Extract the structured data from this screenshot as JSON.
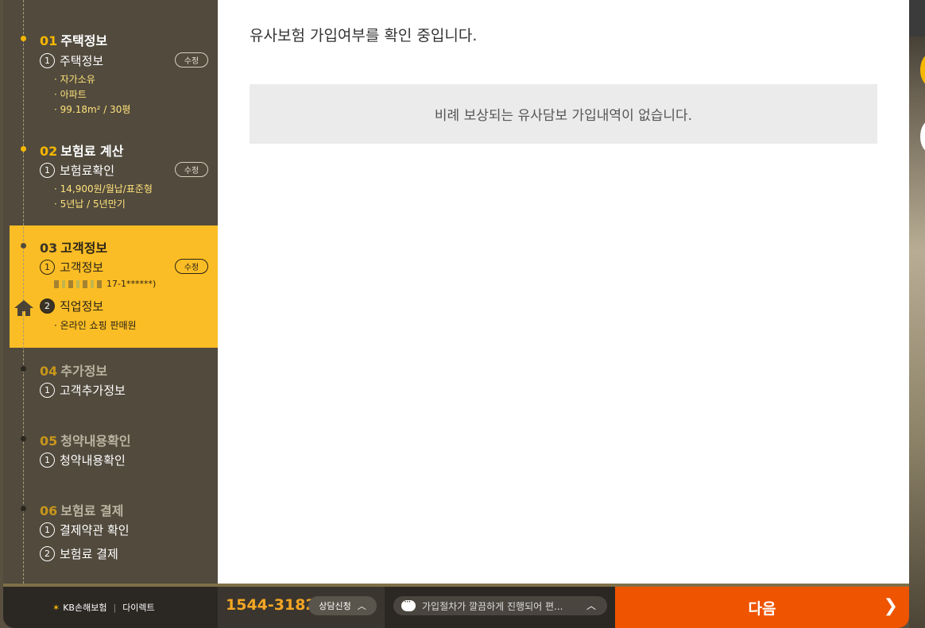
{
  "sidebar": {
    "steps": [
      {
        "num": "01",
        "title": "주택정보",
        "subs": [
          {
            "num": "1",
            "label": "주택정보",
            "edit": "수정"
          }
        ],
        "details": [
          "· 자가소유",
          "· 아파트",
          "· 99.18m² / 30평"
        ]
      },
      {
        "num": "02",
        "title": "보험료 계산",
        "subs": [
          {
            "num": "1",
            "label": "보험료확인",
            "edit": "수정"
          }
        ],
        "details": [
          "· 14,900원/월납/표준형",
          "· 5년납 / 5년만기"
        ]
      },
      {
        "num": "03",
        "title": "고객정보",
        "subs": [
          {
            "num": "1",
            "label": "고객정보",
            "edit": "수정",
            "detail": "17-1******)"
          },
          {
            "num": "2",
            "label": "직업정보",
            "detail": "· 온라인 쇼핑 판매원"
          }
        ]
      },
      {
        "num": "04",
        "title": "추가정보",
        "subs": [
          {
            "num": "1",
            "label": "고객추가정보"
          }
        ]
      },
      {
        "num": "05",
        "title": "청약내용확인",
        "subs": [
          {
            "num": "1",
            "label": "청약내용확인"
          }
        ]
      },
      {
        "num": "06",
        "title": "보험료 결제",
        "subs": [
          {
            "num": "1",
            "label": "결제약관 확인"
          },
          {
            "num": "2",
            "label": "보험료 결제"
          }
        ]
      }
    ]
  },
  "main": {
    "title": "유사보험 가입여부를 확인 중입니다.",
    "notice": "비례 보상되는 유사담보 가입내역이 없습니다."
  },
  "footer": {
    "logo_mark": "KB",
    "logo_text": "KB손해보험",
    "logo_sub": "다이렉트",
    "phone": "1544-3182",
    "consult_label": "상담신청",
    "chat_text": "가입절차가 깔끔하게 진행되어 편...",
    "next_label": "다음"
  },
  "colors": {
    "accent": "#f5b700",
    "active_step_bg": "#fbbd25",
    "sidebar_bg": "#514a3d",
    "next_button": "#ef5400"
  },
  "icons": {
    "home": "home-icon",
    "chat": "chat-bubble-icon",
    "chevron_up": "chevron-up-icon",
    "chevron_right": "chevron-right-icon"
  }
}
